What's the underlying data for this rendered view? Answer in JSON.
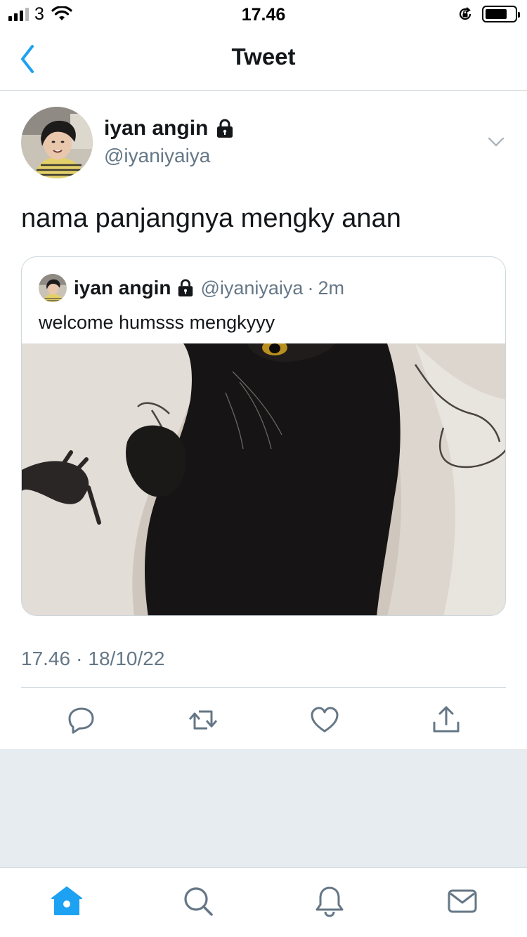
{
  "status_bar": {
    "carrier": "3",
    "time": "17.46",
    "battery_level": 0.75
  },
  "nav": {
    "title": "Tweet",
    "back_icon": "chevron-left-icon"
  },
  "tweet": {
    "display_name": "iyan angin",
    "handle": "@iyaniyaiya",
    "protected_icon": "lock-icon",
    "text": "nama panjangnya mengky anan",
    "quoted": {
      "display_name": "iyan angin",
      "handle": "@iyaniyaiya",
      "separator": "·",
      "time": "2m",
      "text": "welcome humsss mengkyyy"
    },
    "timestamp": {
      "time": "17.46",
      "separator": "·",
      "date": "18/10/22"
    }
  },
  "actions": [
    "reply-icon",
    "retweet-icon",
    "like-icon",
    "share-icon"
  ],
  "tab_bar": {
    "items": [
      "home-icon",
      "search-icon",
      "notifications-icon",
      "messages-icon"
    ],
    "active": "home",
    "accent": "#1da1f2"
  },
  "colors": {
    "accent": "#1da1f2",
    "text": "#14171a",
    "secondary": "#657786",
    "border": "#ccd6dd",
    "background_gray": "#e6ecf0"
  }
}
